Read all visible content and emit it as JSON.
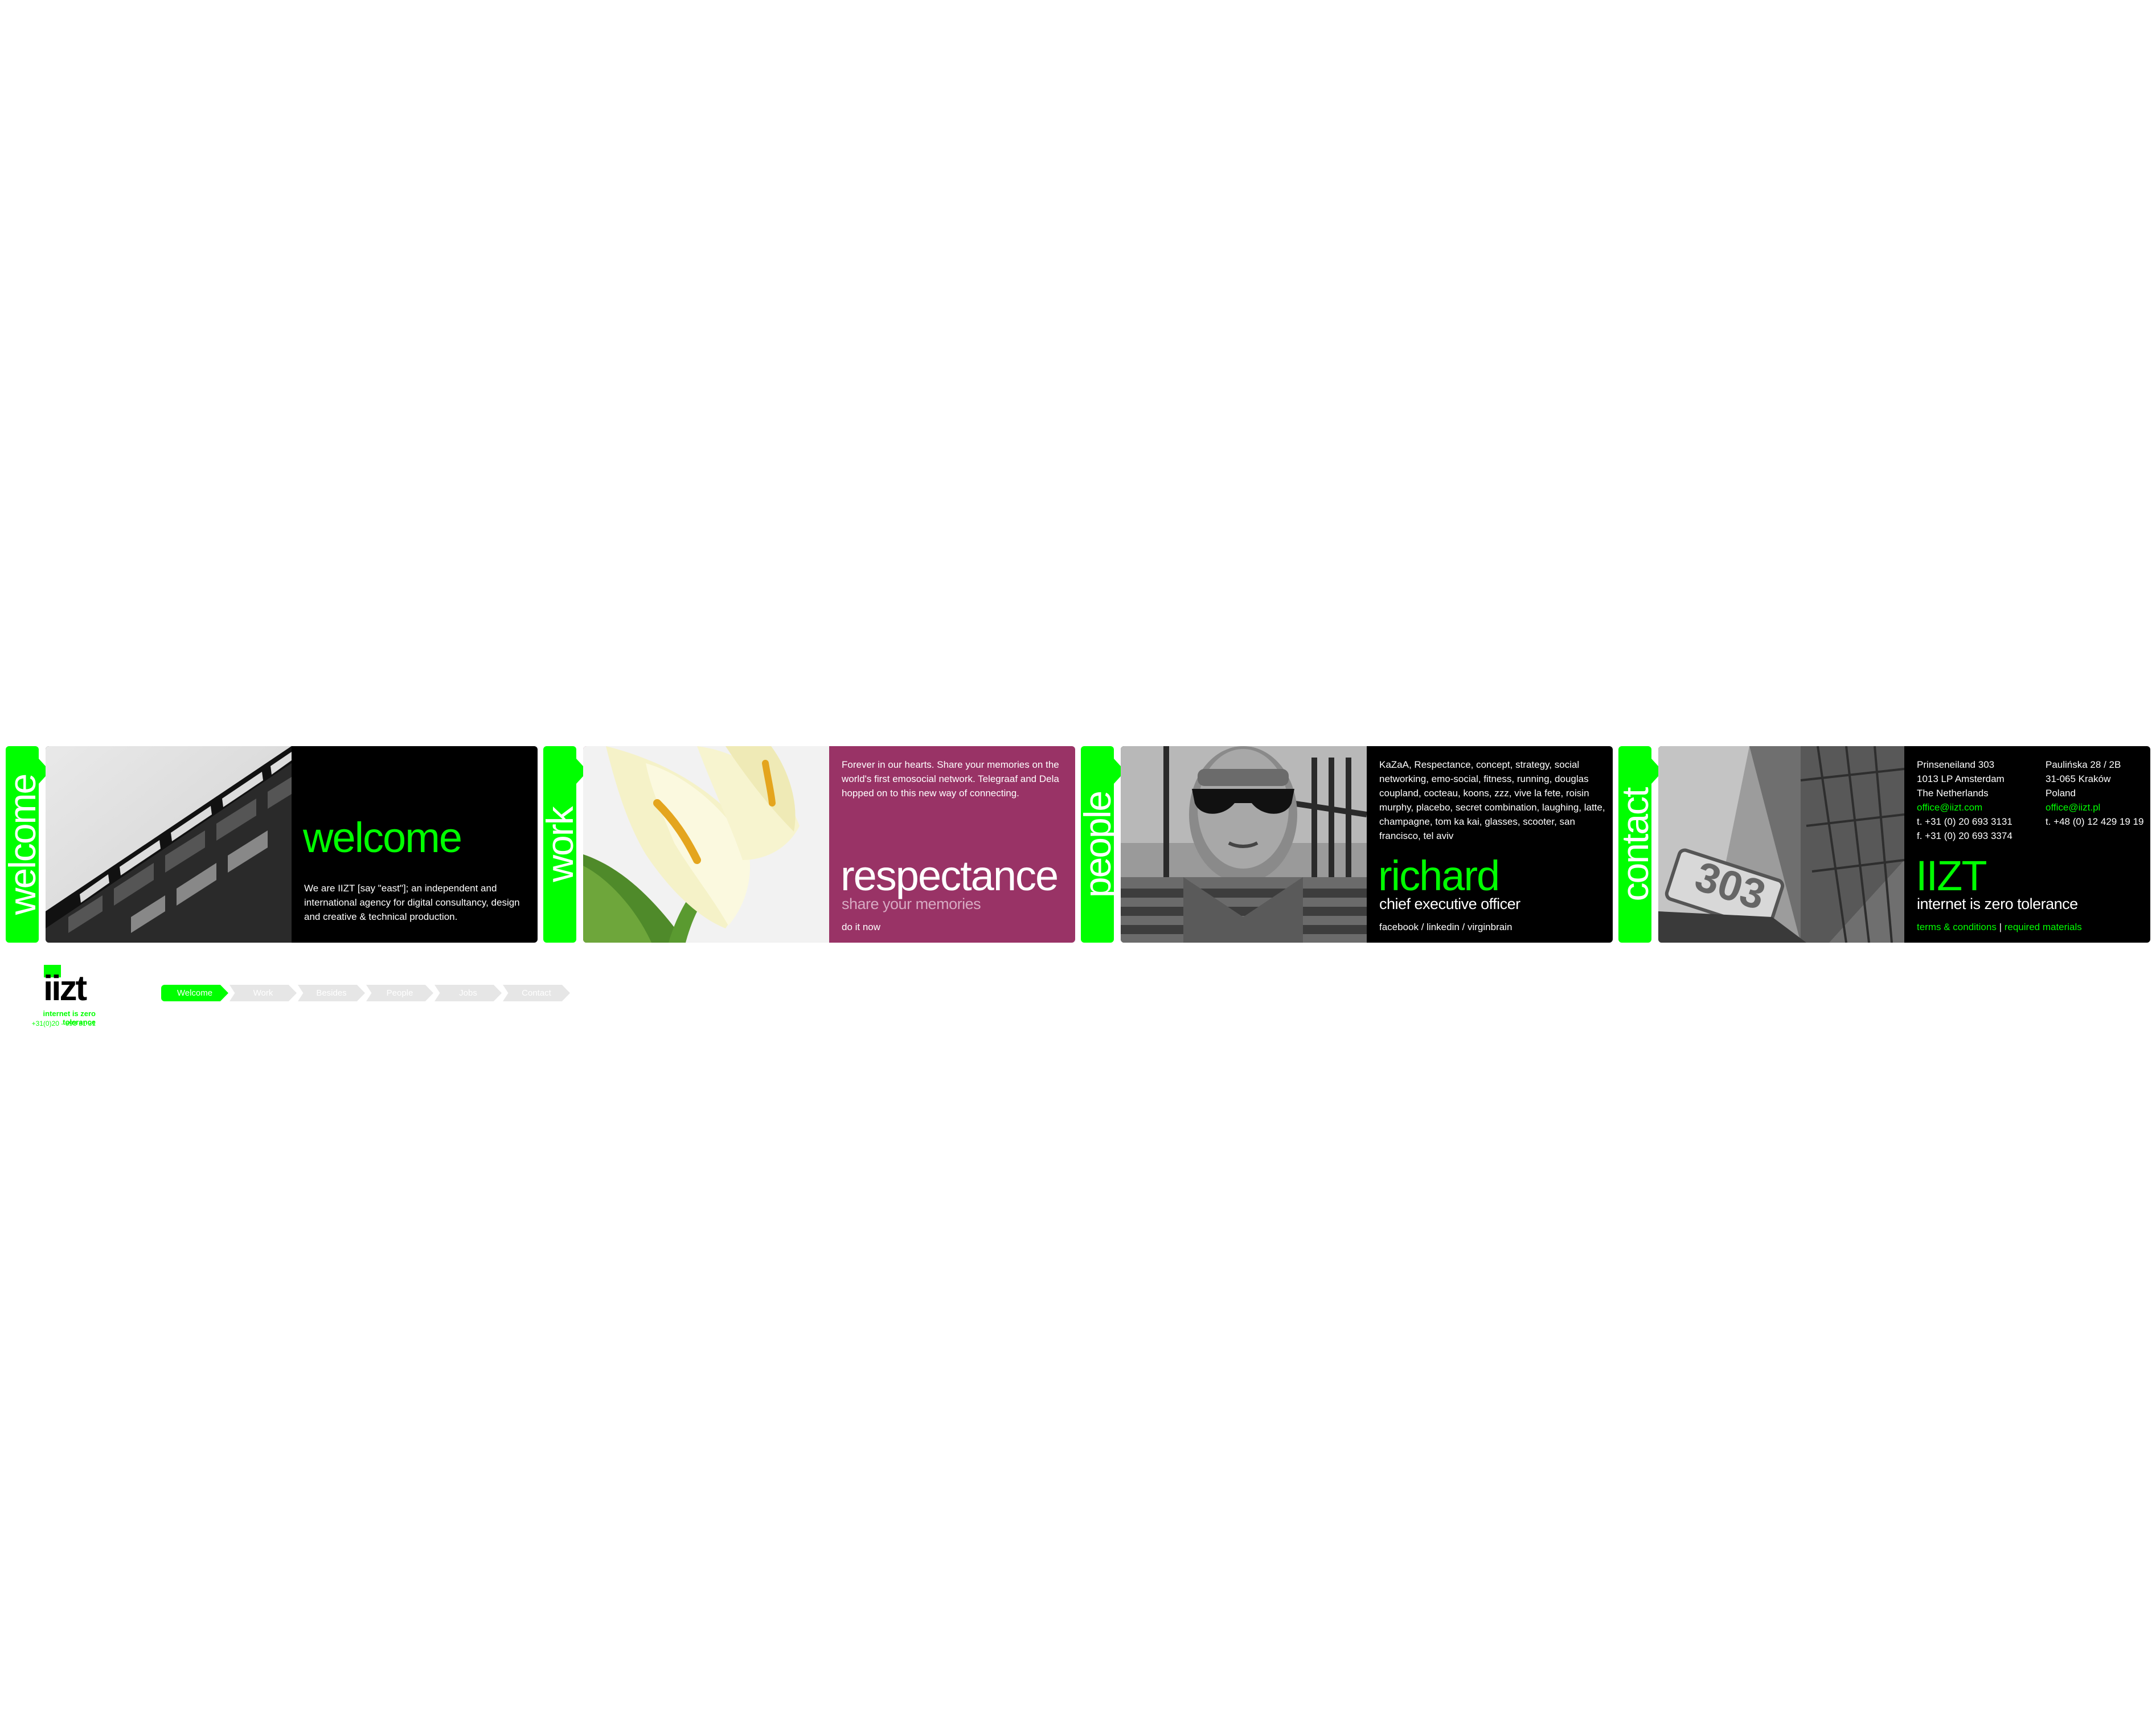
{
  "colors": {
    "accent": "#00ff00",
    "panel_dark": "#000000",
    "panel_magenta": "#993366",
    "nav_inactive": "#e6e6e6"
  },
  "sections": {
    "welcome": {
      "tab_label": "welcome",
      "heading": "welcome",
      "body": "We are IIZT [say \"east\"]; an independent and international agency for digital consultancy, design and creative & technical production."
    },
    "work": {
      "tab_label": "work",
      "intro": "Forever in our hearts. Share your memories on the world's first emosocial network. Telegraaf and Dela hopped on to this new way of connecting.",
      "heading": "respectance",
      "subheading": "share your memories",
      "cta": "do it now"
    },
    "people": {
      "tab_label": "people",
      "interests": "KaZaA, Respectance, concept, strategy, social networking, emo-social, fitness, running, douglas coupland, cocteau, koons, zzz, vive la fete, roisin murphy, placebo, secret combination, laughing, latte, champagne, tom ka kai, glasses, scooter, san francisco, tel aviv",
      "name": "richard",
      "role": "chief executive officer",
      "links": "facebook / linkedin / virginbrain"
    },
    "contact": {
      "tab_label": "contact",
      "nl": {
        "street": "Prinseneiland 303",
        "city": "1013 LP Amsterdam",
        "country": "The Netherlands",
        "email": "office@iizt.com",
        "tel": "t. +31 (0) 20 693 3131",
        "fax": "f. +31 (0) 20 693 3374"
      },
      "pl": {
        "street": "Paulińska 28 / 2B",
        "city": "31-065 Kraków",
        "country": "Poland",
        "email": "office@iizt.pl",
        "tel": "t. +48 (0) 12 429 19 19"
      },
      "heading": "IIZT",
      "tagline": "internet is zero tolerance",
      "terms": "terms & conditions",
      "separator": "|",
      "required": "required materials",
      "photo_number": "303"
    }
  },
  "footer": {
    "logo_text": "iizt",
    "tagline": "internet is zero tolerance",
    "phone": "+31(0)20 - 693 31 31"
  },
  "nav": {
    "items": [
      "Welcome",
      "Work",
      "Besides",
      "People",
      "Jobs",
      "Contact"
    ],
    "active_index": 0
  }
}
